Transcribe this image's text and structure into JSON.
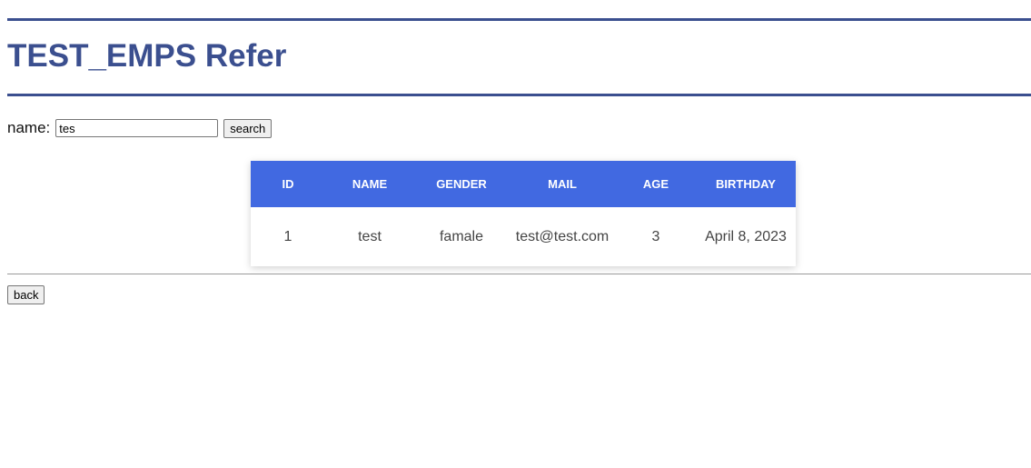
{
  "header": {
    "title": "TEST_EMPS Refer"
  },
  "search": {
    "label": "name:",
    "value": "tes",
    "button_label": "search"
  },
  "table": {
    "columns": [
      "ID",
      "NAME",
      "GENDER",
      "MAIL",
      "AGE",
      "BIRTHDAY"
    ],
    "rows": [
      [
        "1",
        "test",
        "famale",
        "test@test.com",
        "3",
        "April 8, 2023"
      ]
    ],
    "header_color": "#4169e1"
  },
  "footer": {
    "back_label": "back"
  },
  "colors": {
    "title": "#3b4f8f",
    "rule": "#3b4f8f"
  }
}
